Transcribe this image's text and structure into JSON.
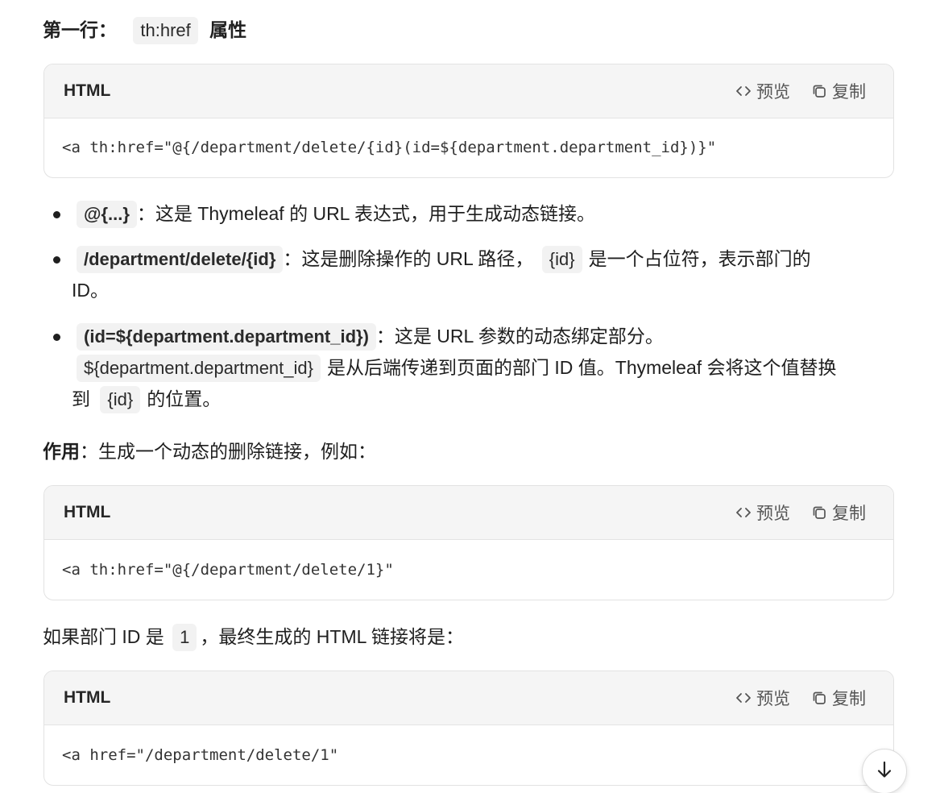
{
  "heading": {
    "prefix": "第一行：",
    "code": "th:href",
    "suffix": "属性"
  },
  "code_blocks": [
    {
      "lang": "HTML",
      "preview_label": "预览",
      "copy_label": "复制",
      "code": "<a th:href=\"@{/department/delete/{id}(id=${department.department_id})}\""
    },
    {
      "lang": "HTML",
      "preview_label": "预览",
      "copy_label": "复制",
      "code": "<a th:href=\"@{/department/delete/1}\""
    },
    {
      "lang": "HTML",
      "preview_label": "预览",
      "copy_label": "复制",
      "code": "<a href=\"/department/delete/1\""
    }
  ],
  "bullets": [
    {
      "code": "@{...}",
      "text": "：这是 Thymeleaf 的 URL 表达式，用于生成动态链接。"
    },
    {
      "code": "/department/delete/{id}",
      "text_a": "：这是删除操作的 URL 路径，",
      "code2": "{id}",
      "text_b": "是一个占位符，表示部门的",
      "text_c": "ID。"
    },
    {
      "code": "(id=${department.department_id})",
      "text_a": "：这是 URL 参数的动态绑定部分。",
      "code2": "${department.department_id}",
      "text_b": "是从后端传递到页面的部门 ID 值。Thymeleaf 会将这个值替换",
      "text_c": "到",
      "code3": "{id}",
      "text_d": "的位置。"
    }
  ],
  "purpose": {
    "label": "作用",
    "text": "：生成一个动态的删除链接，例如："
  },
  "if_line": {
    "text_a": "如果部门 ID 是",
    "code": "1",
    "text_b": "，最终生成的 HTML 链接将是："
  },
  "icons": {
    "preview": "code-brackets-icon",
    "copy": "copy-icon",
    "scroll": "arrow-down-icon"
  }
}
